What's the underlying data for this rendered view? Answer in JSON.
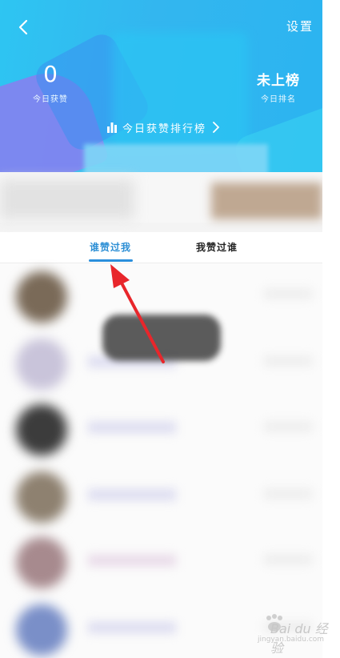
{
  "header": {
    "settings_label": "设置",
    "today_likes_count": "0",
    "today_likes_label": "今日获赞",
    "rank_value": "未上榜",
    "rank_label": "今日排名",
    "leaderboard_label": "今日获赞排行榜"
  },
  "tabs": [
    {
      "label": "谁赞过我",
      "active": true
    },
    {
      "label": "我赞过谁",
      "active": false
    }
  ],
  "colors": {
    "header_blue": "#33b6ef",
    "accent_tab": "#2d8fd5",
    "annotation_arrow": "#e8262b"
  },
  "watermark": {
    "brand": "Bai du 经验",
    "url": "jingyan.baidu.com"
  },
  "icons": [
    "back-chevron-icon",
    "bar-chart-icon",
    "chevron-right-icon",
    "baidu-paw-icon"
  ]
}
